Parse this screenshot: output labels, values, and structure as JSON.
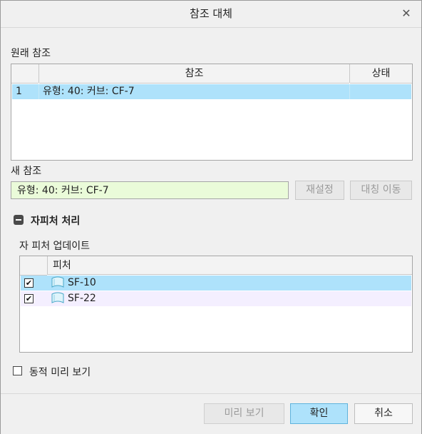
{
  "window": {
    "title": "참조 대체",
    "close_icon": "close-icon"
  },
  "original_reference": {
    "label": "원래 참조",
    "columns": [
      "참조",
      "상태"
    ],
    "rows": [
      {
        "index": "1",
        "reference": "유형: 40: 커브: CF-7",
        "status": ""
      }
    ]
  },
  "new_reference": {
    "label": "새 참조",
    "value": "유형: 40: 커브: CF-7",
    "reset_label": "재설정",
    "move_label": "대칭 이동"
  },
  "child_handling": {
    "title": "자피처 처리",
    "update_label": "자 피처 업데이트",
    "column": "피처",
    "rows": [
      {
        "checked": true,
        "name": "SF-10",
        "icon": "surface-feature-icon"
      },
      {
        "checked": true,
        "name": "SF-22",
        "icon": "surface-feature-icon"
      }
    ]
  },
  "dynamic_preview": {
    "label": "동적 미리 보기",
    "checked": false
  },
  "footer": {
    "preview_label": "미리 보기",
    "ok_label": "확인",
    "cancel_label": "취소"
  },
  "colors": {
    "selected_row": "#aee2fb",
    "alt_row": "#f4efff",
    "new_ref_bg": "#eafbd9"
  }
}
